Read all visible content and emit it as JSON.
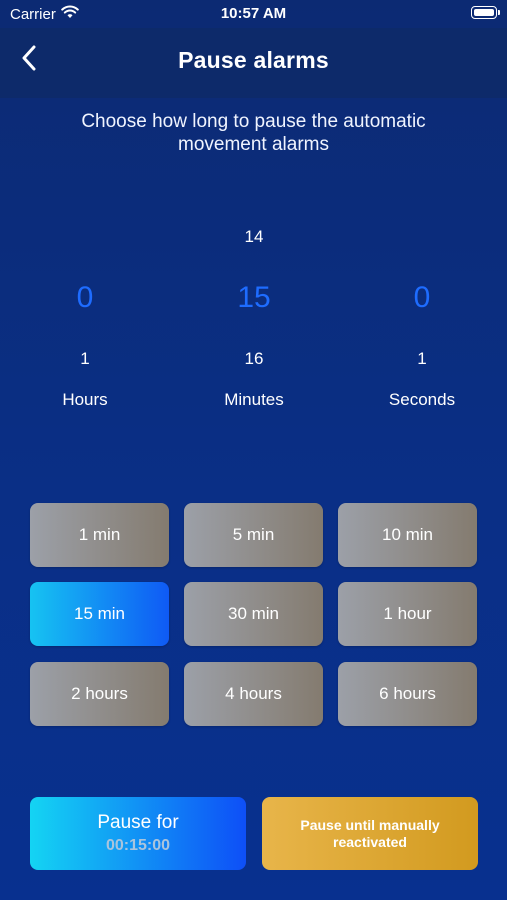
{
  "status_bar": {
    "carrier": "Carrier",
    "time": "10:57 AM",
    "icons": [
      "wifi-icon",
      "battery-icon"
    ]
  },
  "header": {
    "title": "Pause alarms",
    "back_icon": "chevron-left-icon"
  },
  "subtitle": "Choose how long to pause the automatic movement alarms",
  "picker": {
    "hours": {
      "prev": "",
      "current": "0",
      "next": "1",
      "label": "Hours"
    },
    "minutes": {
      "prev": "14",
      "current": "15",
      "next": "16",
      "label": "Minutes"
    },
    "seconds": {
      "prev": "",
      "current": "0",
      "next": "1",
      "label": "Seconds"
    }
  },
  "presets": [
    {
      "label": "1 min"
    },
    {
      "label": "5 min"
    },
    {
      "label": "10 min"
    },
    {
      "label": "15 min",
      "selected": true
    },
    {
      "label": "30 min"
    },
    {
      "label": "1 hour"
    },
    {
      "label": "2 hours"
    },
    {
      "label": "4 hours"
    },
    {
      "label": "6 hours"
    }
  ],
  "actions": {
    "pause_for_label": "Pause for",
    "pause_for_time": "00:15:00",
    "pause_manual_label": "Pause until manually reactivated"
  },
  "colors": {
    "background": "#0a2f86",
    "picker_selected": "#1e6cff",
    "accent_gradient_start": "#14d4f3",
    "accent_gradient_end": "#0e4ff7",
    "gold": "#d29a1f",
    "preset_gray": "#9ca0a8"
  }
}
